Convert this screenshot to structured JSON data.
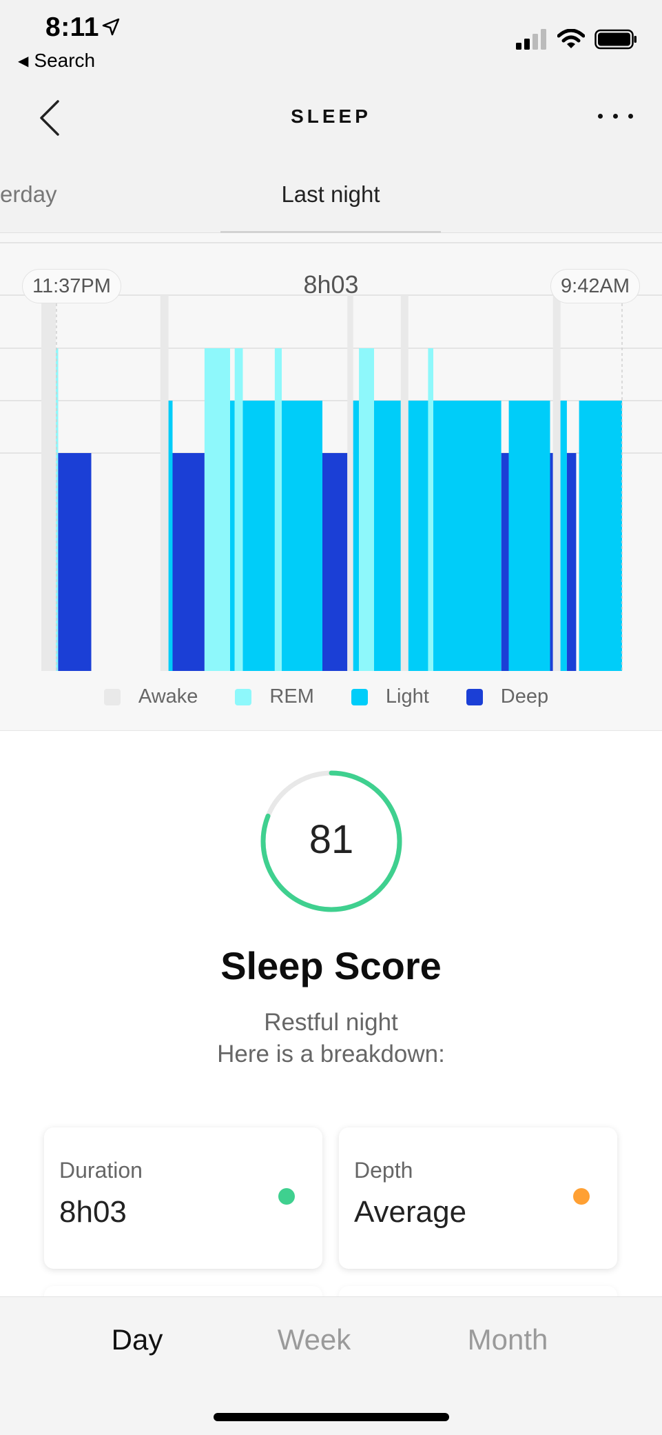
{
  "status_bar": {
    "time": "8:11",
    "back_label": "Search",
    "icons": [
      "location-arrow-icon",
      "signal-icon",
      "wifi-icon",
      "battery-icon"
    ]
  },
  "nav": {
    "title": "SLEEP",
    "back_icon": "chevron-left-icon",
    "more_icon": "more-horizontal-icon"
  },
  "day_tabs": {
    "previous": "erday",
    "current": "Last night"
  },
  "chart_header": {
    "start_time": "11:37PM",
    "duration": "8h03",
    "end_time": "9:42AM"
  },
  "chart_data": {
    "type": "bar",
    "stages": [
      "Awake",
      "REM",
      "Light",
      "Deep"
    ],
    "colors": {
      "Awake": "#e9e9e9",
      "REM": "#8ef8fb",
      "Light": "#00cdf9",
      "Deep": "#1b3fd6"
    },
    "segments": [
      {
        "stage": "Awake",
        "start": 0.0,
        "end": 0.025
      },
      {
        "stage": "REM",
        "start": 0.025,
        "end": 0.029
      },
      {
        "stage": "Deep",
        "start": 0.029,
        "end": 0.086
      },
      {
        "stage": "Awake",
        "start": 0.205,
        "end": 0.219
      },
      {
        "stage": "Light",
        "start": 0.219,
        "end": 0.226
      },
      {
        "stage": "Deep",
        "start": 0.226,
        "end": 0.281
      },
      {
        "stage": "REM",
        "start": 0.281,
        "end": 0.325
      },
      {
        "stage": "Light",
        "start": 0.325,
        "end": 0.333
      },
      {
        "stage": "REM",
        "start": 0.333,
        "end": 0.347
      },
      {
        "stage": "Light",
        "start": 0.347,
        "end": 0.402
      },
      {
        "stage": "REM",
        "start": 0.402,
        "end": 0.414
      },
      {
        "stage": "Light",
        "start": 0.414,
        "end": 0.484
      },
      {
        "stage": "Deep",
        "start": 0.484,
        "end": 0.527
      },
      {
        "stage": "Awake",
        "start": 0.527,
        "end": 0.537
      },
      {
        "stage": "Light",
        "start": 0.537,
        "end": 0.547
      },
      {
        "stage": "REM",
        "start": 0.547,
        "end": 0.573
      },
      {
        "stage": "Light",
        "start": 0.573,
        "end": 0.619
      },
      {
        "stage": "Awake",
        "start": 0.619,
        "end": 0.632
      },
      {
        "stage": "Light",
        "start": 0.632,
        "end": 0.666
      },
      {
        "stage": "REM",
        "start": 0.666,
        "end": 0.675
      },
      {
        "stage": "Light",
        "start": 0.675,
        "end": 0.792
      },
      {
        "stage": "Deep",
        "start": 0.792,
        "end": 0.805
      },
      {
        "stage": "Light",
        "start": 0.805,
        "end": 0.876
      },
      {
        "stage": "Deep",
        "start": 0.876,
        "end": 0.881
      },
      {
        "stage": "Awake",
        "start": 0.881,
        "end": 0.894
      },
      {
        "stage": "Light",
        "start": 0.894,
        "end": 0.905
      },
      {
        "stage": "Deep",
        "start": 0.905,
        "end": 0.921
      },
      {
        "stage": "Light",
        "start": 0.926,
        "end": 1.0
      }
    ]
  },
  "legend": [
    {
      "label": "Awake",
      "color": "#e9e9e9"
    },
    {
      "label": "REM",
      "color": "#8ef8fb"
    },
    {
      "label": "Light",
      "color": "#00cdf9"
    },
    {
      "label": "Deep",
      "color": "#1b3fd6"
    }
  ],
  "score": {
    "value": "81",
    "fraction": 0.81,
    "ring_color": "#3fd08f",
    "title": "Sleep Score",
    "subtitle_line1": "Restful night",
    "subtitle_line2": "Here is a breakdown:"
  },
  "cards": [
    {
      "label": "Duration",
      "value": "8h03",
      "dot_color": "#3fd08f"
    },
    {
      "label": "Depth",
      "value": "Average",
      "dot_color": "#ffa033"
    }
  ],
  "period_tabs": [
    {
      "label": "Day",
      "active": true
    },
    {
      "label": "Week",
      "active": false
    },
    {
      "label": "Month",
      "active": false
    }
  ]
}
